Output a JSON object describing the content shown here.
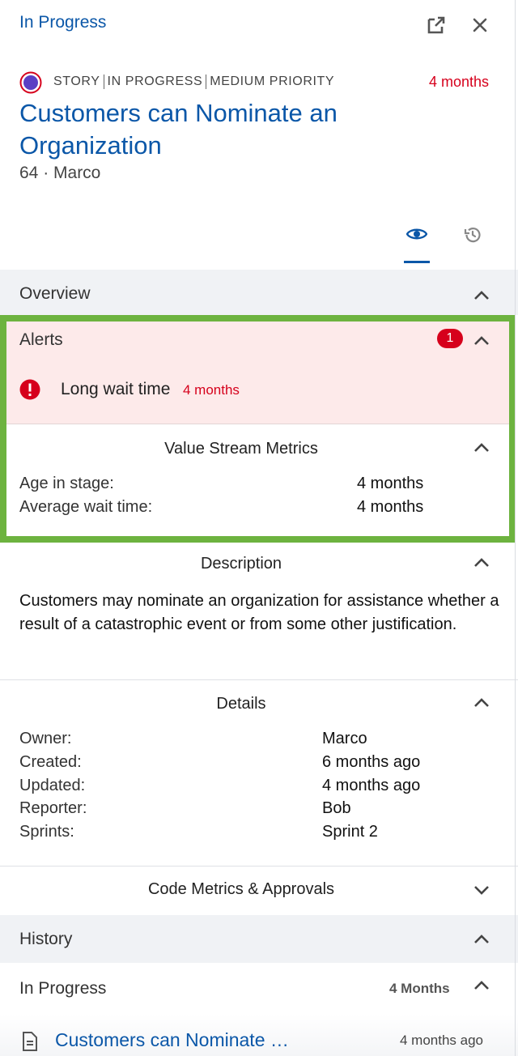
{
  "header": {
    "status_title": "In Progress",
    "open_external_icon": "open-external-icon",
    "close_icon": "close-icon"
  },
  "item": {
    "type": "STORY",
    "state": "IN PROGRESS",
    "priority": "MEDIUM PRIORITY",
    "age": "4 months",
    "title": "Customers can Nominate an Organization",
    "meta": "64 · Marco"
  },
  "tabs": [
    {
      "icon": "eye-icon",
      "active": true
    },
    {
      "icon": "history-icon",
      "active": false
    }
  ],
  "overview": {
    "label": "Overview"
  },
  "alerts": {
    "label": "Alerts",
    "count": "1",
    "items": [
      {
        "text": "Long wait time",
        "age": "4 months"
      }
    ]
  },
  "value_stream": {
    "label": "Value Stream Metrics",
    "rows": [
      {
        "label": "Age in stage:",
        "value": "4 months"
      },
      {
        "label": "Average wait time:",
        "value": "4 months"
      }
    ]
  },
  "description": {
    "label": "Description",
    "text": "Customers may nominate an organization for assistance whether a result of a catastrophic event or from some other justification."
  },
  "details": {
    "label": "Details",
    "rows": [
      {
        "label": "Owner:",
        "value": "Marco"
      },
      {
        "label": "Created:",
        "value": "6 months ago"
      },
      {
        "label": "Updated:",
        "value": "4 months ago"
      },
      {
        "label": "Reporter:",
        "value": "Bob"
      },
      {
        "label": "Sprints:",
        "value": "Sprint 2"
      }
    ]
  },
  "code_metrics": {
    "label": "Code Metrics & Approvals"
  },
  "history": {
    "label": "History",
    "group_label": "In Progress",
    "group_age": "4 Months",
    "entries": [
      {
        "title": "Customers can Nominate …",
        "age": "4 months ago"
      }
    ]
  },
  "colors": {
    "accent": "#0b57a8",
    "alert_red": "#d6001c",
    "alert_bg": "#fdeaea",
    "highlight_border": "#6db33f",
    "section_bg": "#f0f2f5"
  }
}
